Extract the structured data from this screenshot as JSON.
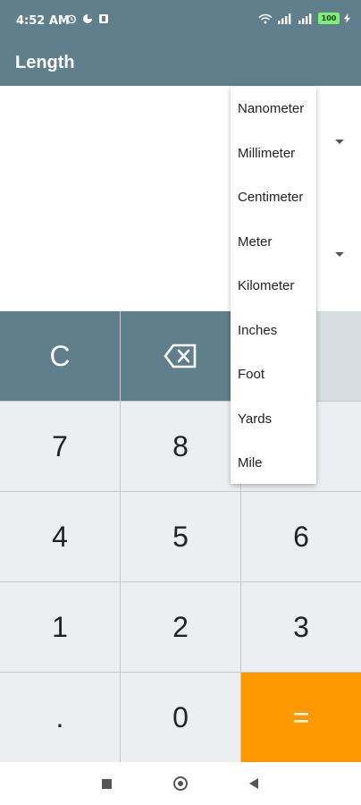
{
  "status_bar": {
    "time": "4:52 AM",
    "battery": "100"
  },
  "app_bar": {
    "title": "Length"
  },
  "keypad": {
    "clear": "C",
    "seven": "7",
    "eight": "8",
    "four": "4",
    "five": "5",
    "six": "6",
    "one": "1",
    "two": "2",
    "three": "3",
    "dot": ".",
    "zero": "0",
    "equals": "="
  },
  "unit_menu": {
    "items": [
      "Nanometer",
      "Millimeter",
      "Centimeter",
      "Meter",
      "Kilometer",
      "Inches",
      "Foot",
      "Yards",
      "Mile"
    ]
  },
  "colors": {
    "primary": "#5f7f8c",
    "accent": "#ff9800",
    "key_background": "#eceff2"
  },
  "icons": {
    "backspace": "backspace-icon",
    "dropdown": "arrow-drop-down-icon",
    "nav_recents": "square-icon",
    "nav_home": "circle-icon",
    "nav_back": "triangle-back-icon"
  }
}
